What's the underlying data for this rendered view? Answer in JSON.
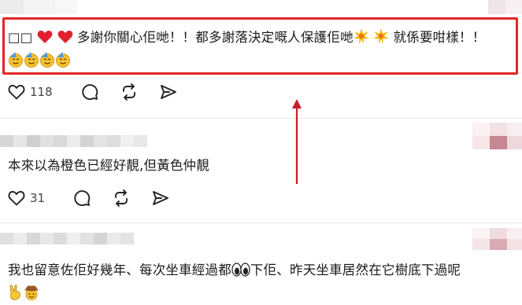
{
  "posts": [
    {
      "text_prefix": "□□",
      "text_main": "多謝你關心佢哋！！都多謝落決定嘅人保護佢哋",
      "text_tail": "就係要咁樣！！",
      "like_count": "118"
    },
    {
      "text": "本來以為橙色已經好靚,但黃色仲靚",
      "like_count": "31"
    },
    {
      "text_main": "我也留意佐佢好幾年、每次坐車經過都",
      "text_tail": "下佢、昨天坐車居然在它樹底下過呢"
    }
  ],
  "icons": {
    "like": "heart-outline-icon",
    "reply": "comment-bubble-icon",
    "repost": "repost-arrows-icon",
    "share": "send-icon"
  },
  "colors": {
    "highlight": "#e3262a",
    "icon": "#222222",
    "divider": "#e6e6e6"
  }
}
